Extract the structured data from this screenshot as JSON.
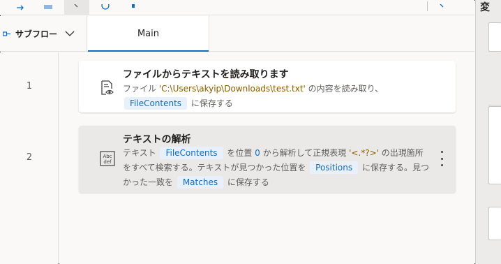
{
  "colors": {
    "accent": "#0f6cbd",
    "selected_card_bg": "#ebe9e7",
    "string_text": "#8a5a00"
  },
  "tabs": {
    "subflow_dropdown_label": "サブフロー",
    "main_tab_label": "Main"
  },
  "actions": [
    {
      "line_number": "1",
      "icon": "read-text-file-icon",
      "title": "ファイルからテキストを読み取ります",
      "desc": {
        "p1": "ファイル ",
        "path": "'C:\\Users\\akyip\\Downloads\\test.txt'",
        "p2": " の内容を読み取り、",
        "var": "FileContents",
        "p3": " に保存する"
      }
    },
    {
      "line_number": "2",
      "icon": "abc-def-parse-text-icon",
      "title": "テキストの解析",
      "desc": {
        "p1": "テキスト ",
        "var1": "FileContents",
        "p2": " を位置 ",
        "pos": "0",
        "p3": " から解析して正規表現 ",
        "regex": "'<.*?>'",
        "p4": " の出現箇所をすべて検索する。テキストが見つかった位置を ",
        "var2": "Positions",
        "p5": " に保存する。見つかった一致を ",
        "var3": "Matches",
        "p6": " に保存する"
      }
    }
  ],
  "right_panel": {
    "title_glyph": "変"
  }
}
